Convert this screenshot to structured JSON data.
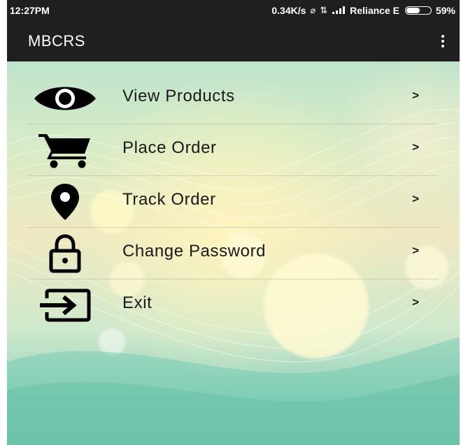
{
  "status_bar": {
    "time": "12:27PM",
    "net_speed": "0.34K/s",
    "carrier": "Reliance E",
    "battery_percent": "59%",
    "battery_level": 0.59
  },
  "app_bar": {
    "title": "MBCRS",
    "menu_icon": "overflow-menu-icon"
  },
  "menu": {
    "items": [
      {
        "label": "View Products",
        "icon": "eye-icon",
        "chevron": ">"
      },
      {
        "label": "Place Order",
        "icon": "shopping-cart-icon",
        "chevron": ">"
      },
      {
        "label": "Track Order",
        "icon": "location-pin-icon",
        "chevron": ">"
      },
      {
        "label": "Change Password",
        "icon": "lock-icon",
        "chevron": ">"
      },
      {
        "label": "Exit",
        "icon": "exit-icon",
        "chevron": ">"
      }
    ]
  },
  "colors": {
    "app_bar": "#1f1f1f",
    "text": "#1a1a1a",
    "icon": "#000000"
  }
}
